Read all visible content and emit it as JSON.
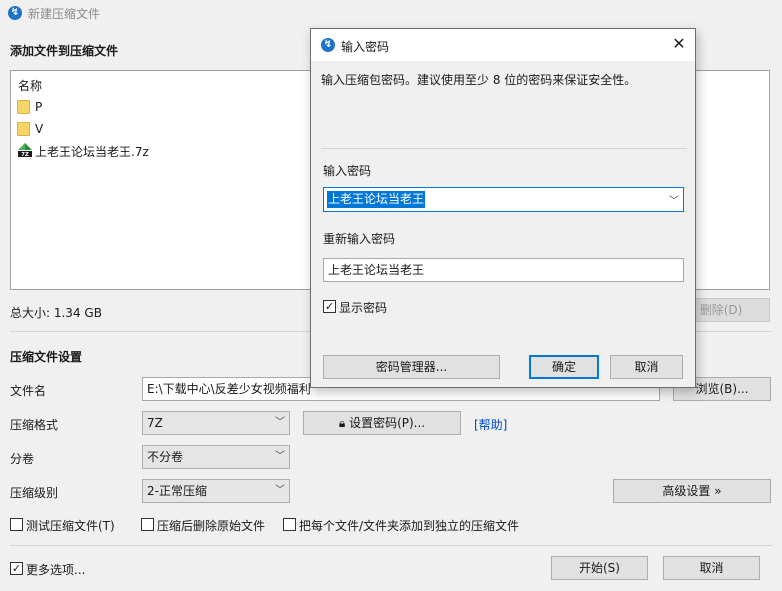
{
  "window": {
    "title": "新建压缩文件"
  },
  "add_section": {
    "title": "添加文件到压缩文件"
  },
  "file_list": {
    "column_name": "名称",
    "items": [
      {
        "name": "P",
        "icon": "folder-icon"
      },
      {
        "name": "V",
        "icon": "folder-icon"
      },
      {
        "name": "上老王论坛当老王.7z",
        "icon": "7z-archive-icon"
      }
    ]
  },
  "total_size": "总大小: 1.34 GB",
  "delete_button": "删除(D)",
  "settings": {
    "title": "压缩文件设置",
    "filename_label": "文件名",
    "filename_value": "E:\\下载中心\\反差少女视频福利",
    "browse_button": "浏览(B)...",
    "format_label": "压缩格式",
    "format_value": "7Z",
    "set_password_button": "设置密码(P)...",
    "help_link": "[帮助]",
    "split_label": "分卷",
    "split_value": "不分卷",
    "level_label": "压缩级别",
    "level_value": "2-正常压缩",
    "advanced_button": "高级设置 »",
    "test_checkbox": "测试压缩文件(T)",
    "delete_after_checkbox": "压缩后删除原始文件",
    "separate_checkbox": "把每个文件/文件夹添加到独立的压缩文件"
  },
  "footer": {
    "more_options": "更多选项...",
    "start_button": "开始(S)",
    "cancel_button": "取消"
  },
  "password_dialog": {
    "title": "输入密码",
    "description": "输入压缩包密码。建议使用至少 8 位的密码来保证安全性。",
    "password_label": "输入密码",
    "password_value": "上老王论坛当老王",
    "confirm_label": "重新输入密码",
    "confirm_value": "上老王论坛当老王",
    "show_password": "显示密码",
    "manager_button": "密码管理器...",
    "ok_button": "确定",
    "cancel_button": "取消"
  },
  "colors": {
    "accent": "#0078d7",
    "link": "#0046c8",
    "folder": "#f6d466"
  }
}
